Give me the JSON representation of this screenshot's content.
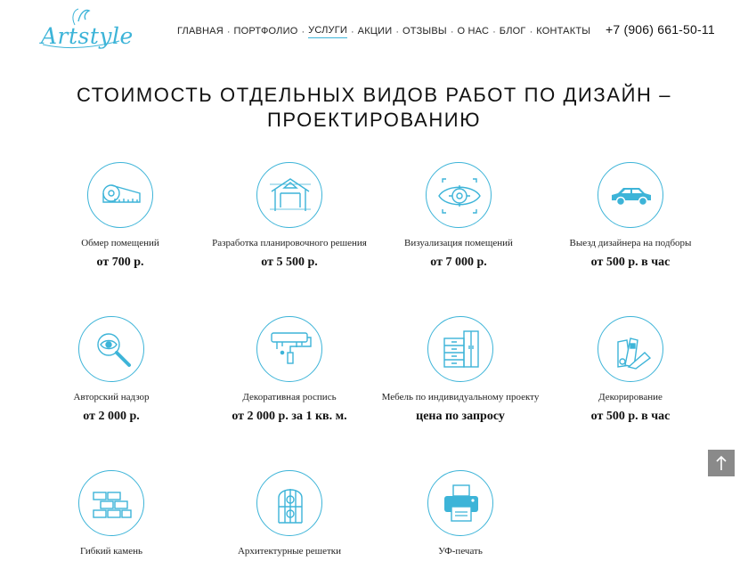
{
  "header": {
    "logo_text": "Artstyle",
    "nav": [
      {
        "label": "Главная",
        "active": false
      },
      {
        "label": "Портфолио",
        "active": false
      },
      {
        "label": "Услуги",
        "active": true
      },
      {
        "label": "Акции",
        "active": false
      },
      {
        "label": "Отзывы",
        "active": false
      },
      {
        "label": "О нас",
        "active": false
      },
      {
        "label": "Блог",
        "active": false
      },
      {
        "label": "Контакты",
        "active": false
      }
    ],
    "separator": "·",
    "phone": "+7 (906) 661-50-11"
  },
  "main": {
    "title": "Стоимость отдельных видов работ по дизайн – проектированию",
    "services": [
      {
        "name": "Обмер помещений",
        "price": "от 700 р.",
        "icon": "tape-measure-icon"
      },
      {
        "name": "Разработка планировочного решения",
        "price": "от 5 500 р.",
        "icon": "floor-plan-icon"
      },
      {
        "name": "Визуализация помещений",
        "price": "от 7 000 р.",
        "icon": "eye-icon"
      },
      {
        "name": "Выезд дизайнера на подборы",
        "price": "от 500 р. в час",
        "icon": "car-icon"
      },
      {
        "name": "Авторский надзор",
        "price": "от 2 000 р.",
        "icon": "magnifier-eye-icon"
      },
      {
        "name": "Декоративная роспись",
        "price": "от 2 000 р. за 1 кв. м.",
        "icon": "paint-roller-icon"
      },
      {
        "name": "Мебель по индивидуальному проекту",
        "price": "цена по запросу",
        "icon": "wardrobe-icon"
      },
      {
        "name": "Декорирование",
        "price": "от 500 р. в час",
        "icon": "color-swatches-icon"
      },
      {
        "name": "Гибкий камень",
        "price": "",
        "icon": "brick-wall-icon"
      },
      {
        "name": "Архитектурные решетки",
        "price": "",
        "icon": "arched-grille-icon"
      },
      {
        "name": "УФ-печать",
        "price": "",
        "icon": "printer-icon"
      }
    ]
  },
  "scroll_top": {
    "icon": "arrow-up-icon"
  },
  "colors": {
    "accent": "#3db4d8",
    "text": "#1a1a1a",
    "scroll_button": "#8a8a8a"
  }
}
